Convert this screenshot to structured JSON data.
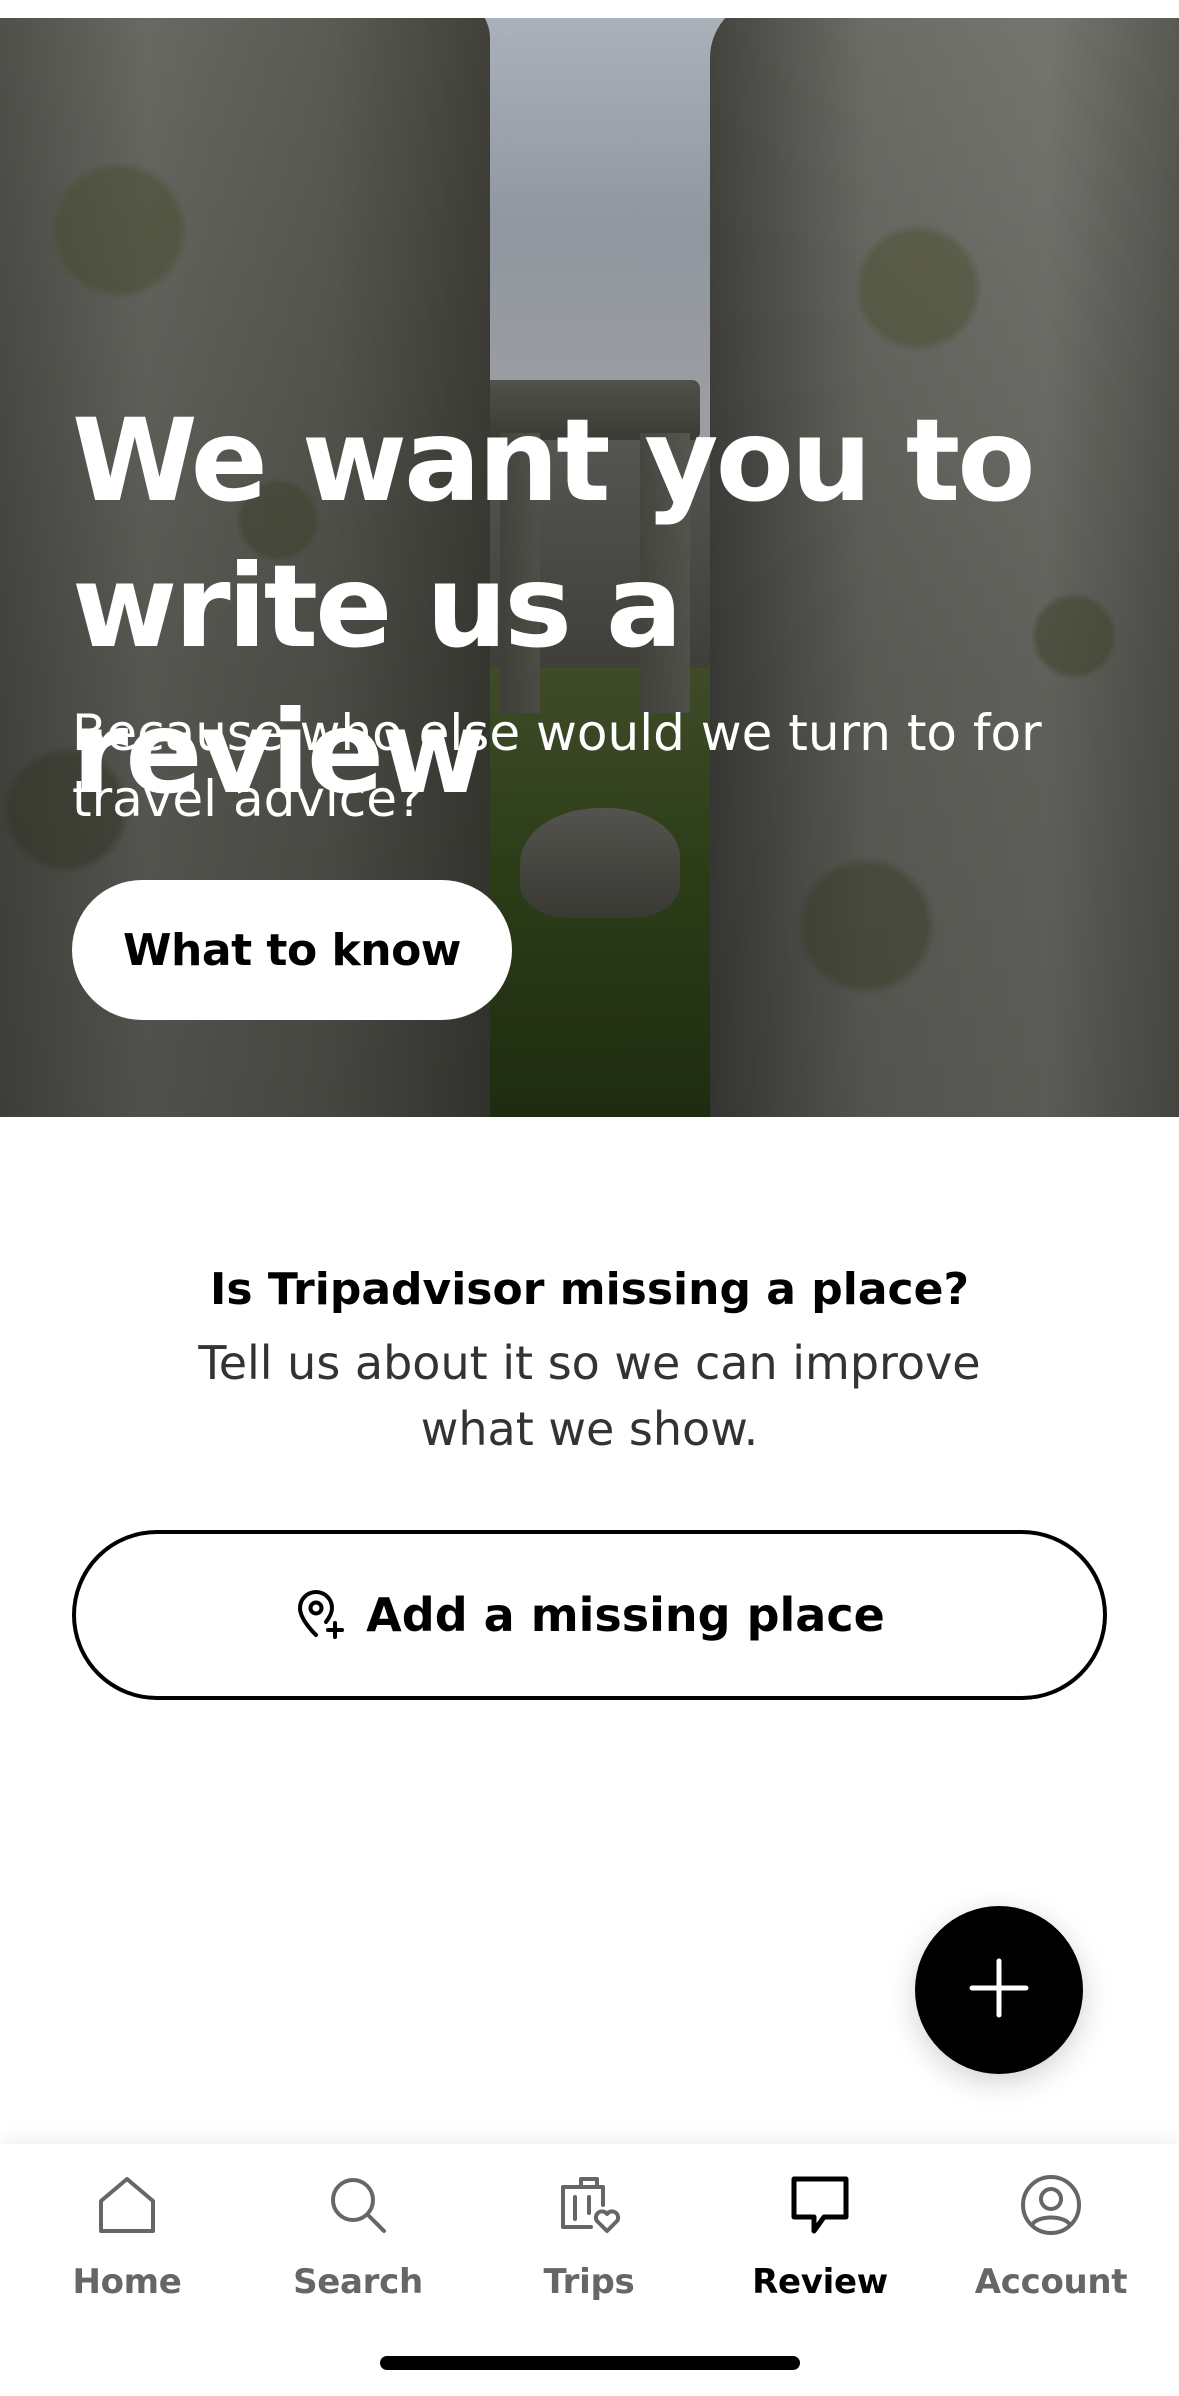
{
  "hero": {
    "title": "We want you to write us a review",
    "subtitle": "Because who else would we turn to for travel advice?",
    "button_label": "What to know"
  },
  "missing_place": {
    "title": "Is Tripadvisor missing a place?",
    "text": "Tell us about it so we can improve what we show.",
    "button_label": "Add a missing place",
    "button_icon": "map-pin-plus-icon"
  },
  "fab": {
    "icon": "plus-icon"
  },
  "tabbar": {
    "items": [
      {
        "label": "Home",
        "icon": "home-icon",
        "active": false
      },
      {
        "label": "Search",
        "icon": "search-icon",
        "active": false
      },
      {
        "label": "Trips",
        "icon": "suitcase-heart-icon",
        "active": false
      },
      {
        "label": "Review",
        "icon": "speech-bubble-icon",
        "active": true
      },
      {
        "label": "Account",
        "icon": "user-circle-icon",
        "active": false
      }
    ]
  },
  "colors": {
    "primary": "#000000",
    "inactive_tab": "#666666",
    "background": "#ffffff"
  }
}
